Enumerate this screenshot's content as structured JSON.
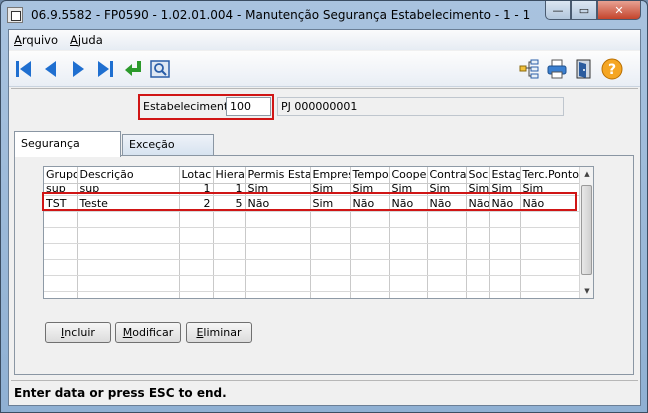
{
  "window": {
    "title": "06.9.5582 - FP0590 - 1.02.01.004 - Manutenção Segurança Estabelecimento - 1 - 1",
    "min_glyph": "—",
    "max_glyph": "▭",
    "close_glyph": "✕"
  },
  "menu": {
    "items": [
      {
        "key": "A",
        "rest": "rquivo"
      },
      {
        "key": "A",
        "rest": "juda"
      }
    ]
  },
  "toolbar": {
    "icons": [
      "first-record-icon",
      "previous-record-icon",
      "next-record-icon",
      "last-record-icon",
      "go-to-icon",
      "search-zoom-icon",
      "tree-structure-icon",
      "print-icon",
      "exit-door-icon",
      "help-icon"
    ],
    "help_glyph": "?"
  },
  "estabelecimento": {
    "label": "Estabelecimento:",
    "value": "100",
    "description": "PJ 000000001"
  },
  "tabs": [
    {
      "label": "Segurança",
      "active": true
    },
    {
      "label": "Exceção",
      "active": false
    }
  ],
  "grid": {
    "columns": [
      "Grupo",
      "Descrição",
      "Lotac",
      "Hierar",
      "Permis Estab",
      "Empres",
      "Tempor",
      "Cooper",
      "Contrat",
      "Soc",
      "Estag",
      "Terc.Ponto"
    ],
    "rows": [
      [
        "sup",
        "sup",
        "1",
        "1",
        "Sim",
        "Sim",
        "Sim",
        "Sim",
        "Sim",
        "Sim",
        "Sim",
        "Sim"
      ],
      [
        "TST",
        "Teste",
        "2",
        "5",
        "Não",
        "Sim",
        "Não",
        "Não",
        "Não",
        "Não",
        "Não",
        "Não"
      ]
    ]
  },
  "buttons": {
    "incluir": {
      "key": "I",
      "rest": "ncluir"
    },
    "modificar": {
      "key": "M",
      "rest": "odificar"
    },
    "eliminar": {
      "key": "E",
      "rest": "liminar"
    }
  },
  "status": {
    "text": "Enter data or press ESC to end."
  },
  "colors": {
    "highlight": "#d01515",
    "nav_blue": "#1f6fd0",
    "go_green": "#2c9a2c",
    "help_orange": "#f5a623"
  }
}
